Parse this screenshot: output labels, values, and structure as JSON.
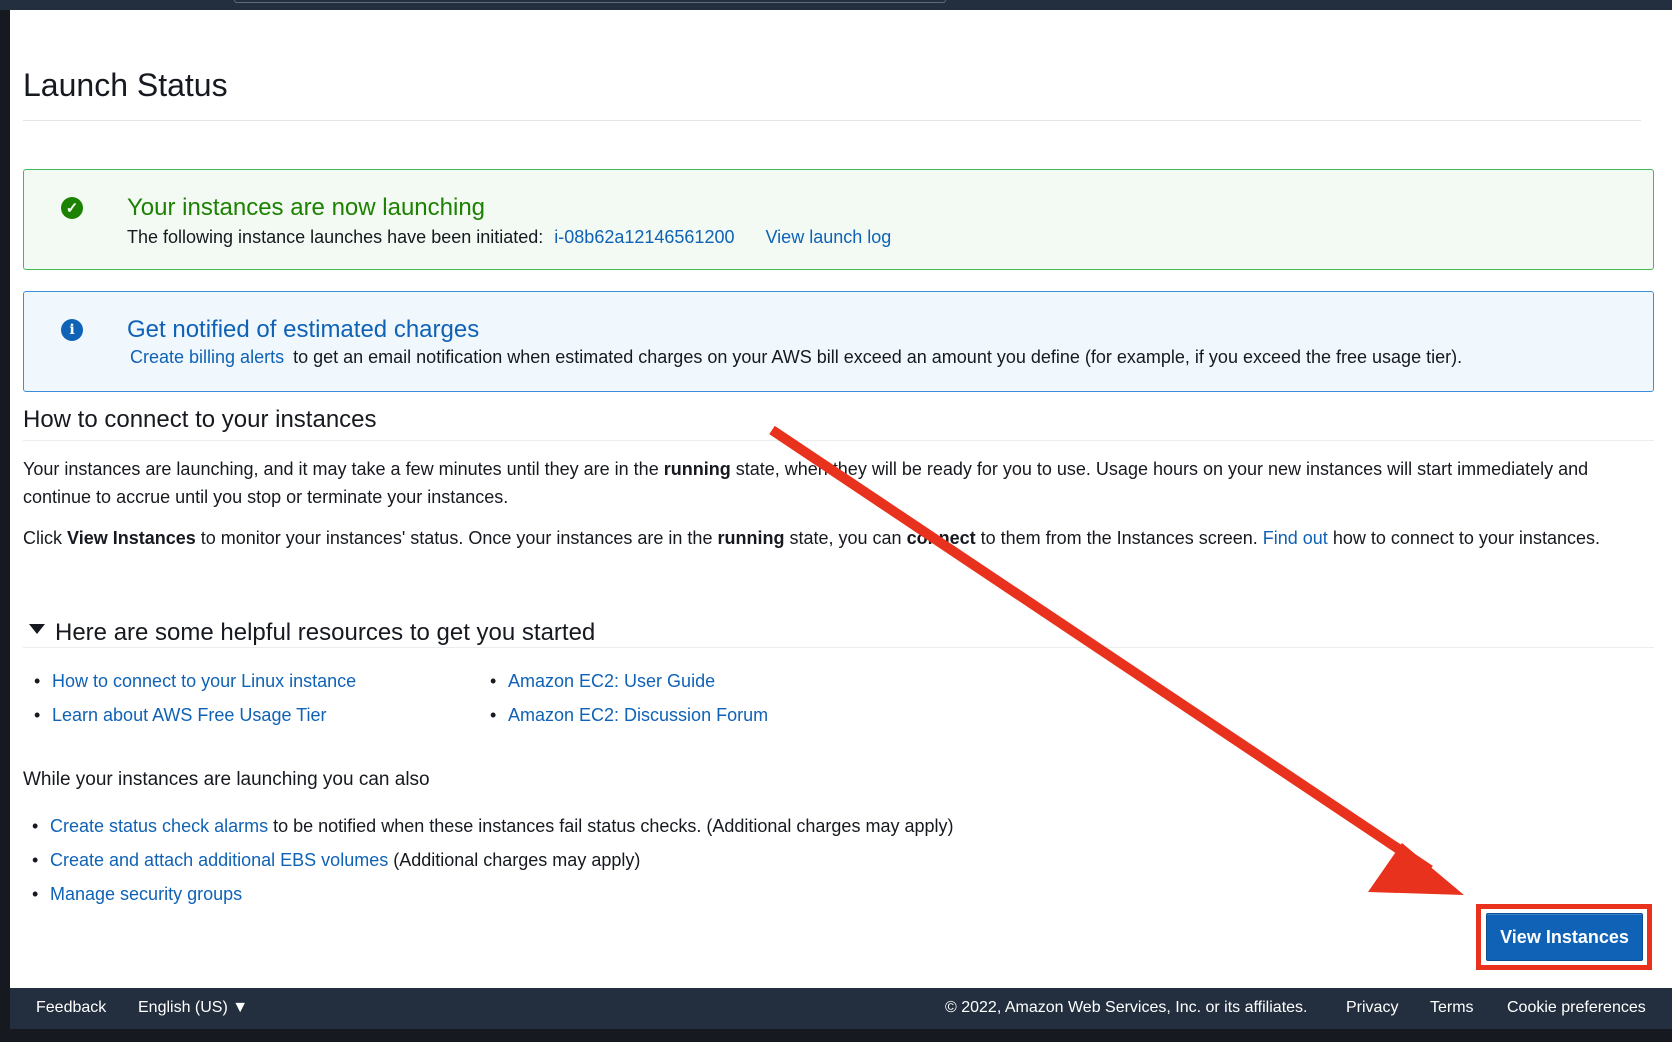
{
  "page": {
    "title": "Launch Status"
  },
  "success_alert": {
    "icon": "check-circle-icon",
    "heading": "Your instances are now launching",
    "text": "The following instance launches have been initiated:",
    "instance_id": "i-08b62a12146561200",
    "launch_log_link": "View launch log"
  },
  "info_alert": {
    "icon": "info-circle-icon",
    "heading": "Get notified of estimated charges",
    "link": "Create billing alerts",
    "text": "to get an email notification when estimated charges on your AWS bill exceed an amount you define (for example, if you exceed the free usage tier)."
  },
  "connect_section": {
    "heading": "How to connect to your instances",
    "para1_a": "Your instances are launching, and it may take a few minutes until they are in the",
    "para1_bold": "running",
    "para1_b": "state, when they will be ready for you to use. Usage hours on your new instances will start immediately and continue to accrue until you stop or terminate your instances.",
    "para2_a": "Click",
    "para2_bold1": "View Instances",
    "para2_b": "to monitor your instances' status. Once your instances are in the",
    "para2_bold2": "running",
    "para2_c": "state, you can",
    "para2_bold3": "connect",
    "para2_d": "to them from the Instances screen.",
    "para2_link": "Find out",
    "para2_e": "how to connect to your instances."
  },
  "resources": {
    "heading": "Here are some helpful resources to get you started",
    "left": [
      "How to connect to your Linux instance",
      "Learn about AWS Free Usage Tier"
    ],
    "right": [
      "Amazon EC2: User Guide",
      "Amazon EC2: Discussion Forum"
    ]
  },
  "also": {
    "heading": "While your instances are launching you can also",
    "items": [
      {
        "link": "Create status check alarms",
        "text": "to be notified when these instances fail status checks. (Additional charges may apply)"
      },
      {
        "link": "Create and attach additional EBS volumes",
        "text": "(Additional charges may apply)"
      },
      {
        "link": "Manage security groups",
        "text": ""
      }
    ]
  },
  "actions": {
    "view_instances": "View Instances"
  },
  "footer": {
    "feedback": "Feedback",
    "language": "English (US) ▼",
    "copyright": "© 2022, Amazon Web Services, Inc. or its affiliates.",
    "privacy": "Privacy",
    "terms": "Terms",
    "cookies": "Cookie preferences"
  },
  "colors": {
    "success": "#1d8102",
    "link": "#0f62b5",
    "annotation_arrow": "#e8321d",
    "footer_bg": "#232f3e"
  }
}
